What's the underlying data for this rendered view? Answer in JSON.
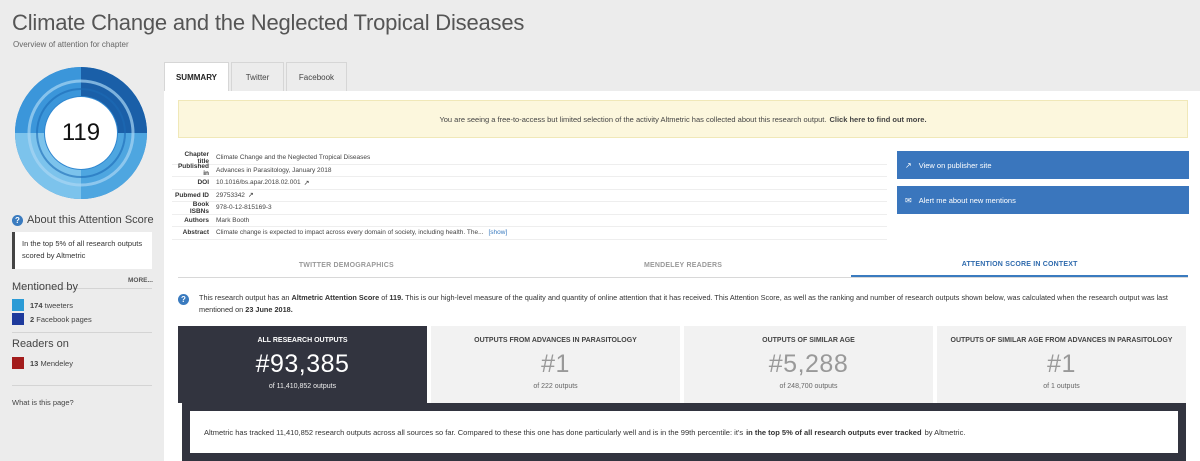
{
  "header": {
    "title": "Climate Change and the Neglected Tropical Diseases",
    "subtitle": "Overview of attention for chapter"
  },
  "sidebar": {
    "score": "119",
    "donut_colors": [
      "#1a5fa8",
      "#2f86cf",
      "#4ea6e0",
      "#7cc3ec"
    ],
    "about_label": "About this Attention Score",
    "top_box_text": "In the top 5% of all research outputs scored by Altmetric",
    "more_label": "MORE...",
    "mentioned_by_heading": "Mentioned by",
    "mentions": [
      {
        "count": "174",
        "label": "tweeters",
        "color": "#2b9bd6"
      },
      {
        "count": "2",
        "label": "Facebook pages",
        "color": "#1e3a9c"
      }
    ],
    "readers_heading": "Readers on",
    "readers": [
      {
        "count": "13",
        "label": "Mendeley",
        "color": "#a31c1c"
      }
    ],
    "what_link": "What is this page?"
  },
  "tabs": [
    {
      "label": "SUMMARY",
      "active": true
    },
    {
      "label": "Twitter",
      "active": false
    },
    {
      "label": "Facebook",
      "active": false
    }
  ],
  "notice": {
    "text": "You are seeing a free-to-access but limited selection of the activity Altmetric has collected about this research output.",
    "link": "Click here to find out more."
  },
  "details": {
    "chapter_title_label": "Chapter title",
    "chapter_title": "Climate Change and the Neglected Tropical Diseases",
    "published_label": "Published in",
    "published": "Advances in Parasitology, January 2018",
    "doi_label": "DOI",
    "doi": "10.1016/bs.apar.2018.02.001",
    "pubmed_label": "Pubmed ID",
    "pubmed": "29753342",
    "isbn_label": "Book ISBNs",
    "isbn": "978-0-12-815169-3",
    "authors_label": "Authors",
    "authors": "Mark Booth",
    "abstract_label": "Abstract",
    "abstract": "Climate change is expected to impact across every domain of society, including health. The...",
    "show_label": "[show]"
  },
  "actions": {
    "publisher_label": "View on publisher site",
    "alert_label": "Alert me about new mentions"
  },
  "subtabs": [
    {
      "label": "TWITTER DEMOGRAPHICS",
      "active": false
    },
    {
      "label": "MENDELEY READERS",
      "active": false
    },
    {
      "label": "ATTENTION SCORE IN CONTEXT",
      "active": true
    }
  ],
  "context": {
    "pre": "This research output has an",
    "score_label": "Altmetric Attention Score",
    "of": "of",
    "score": "119.",
    "mid": "This is our high-level measure of the quality and quantity of online attention that it has received. This Attention Score, as well as the ranking and number of research outputs shown below, was calculated when the research output was last mentioned on",
    "date": "23 June 2018."
  },
  "rank_cards": [
    {
      "heading": "ALL RESEARCH OUTPUTS",
      "rank": "#93,385",
      "footer": "of 11,410,852 outputs",
      "dark": true
    },
    {
      "heading": "OUTPUTS FROM ADVANCES IN PARASITOLOGY",
      "rank": "#1",
      "footer": "of 222 outputs",
      "dark": false
    },
    {
      "heading": "OUTPUTS OF SIMILAR AGE",
      "rank": "#5,288",
      "footer": "of 248,700 outputs",
      "dark": false
    },
    {
      "heading": "OUTPUTS OF SIMILAR AGE FROM ADVANCES IN PARASITOLOGY",
      "rank": "#1",
      "footer": "of 1 outputs",
      "dark": false
    }
  ],
  "summary": {
    "pre": "Altmetric has tracked 11,410,852 research outputs across all sources so far. Compared to these this one has done particularly well and is in the 99th percentile: it's",
    "bold": "in the top 5% of all research outputs ever tracked",
    "post": "by Altmetric."
  }
}
